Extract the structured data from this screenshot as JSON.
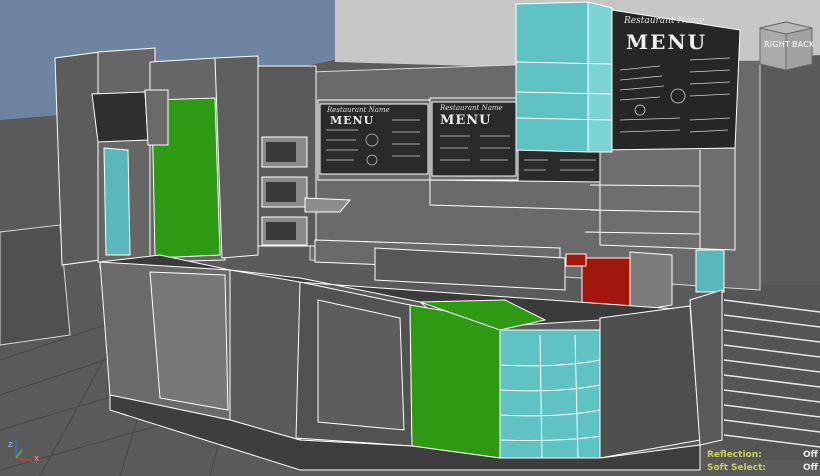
{
  "viewcube": {
    "face_left": "RIGHT",
    "face_right": "BACK"
  },
  "axis": {
    "z_label": "z",
    "x_label": "x"
  },
  "menu_boards": {
    "restaurant_name": "Restaurant Name",
    "menu_word": "MENU"
  },
  "hud": {
    "reflection_label": "Reflection:",
    "reflection_value": "Off",
    "soft_select_label": "Soft Select:",
    "soft_select_value": "Off"
  },
  "colors": {
    "viewport_bg": "#5f5f5f",
    "wire": "#ffffff",
    "green_panel": "#2e9a14",
    "cyan_glass": "#5fc3c4",
    "red_machine": "#a1170e",
    "hud_label": "#c8d25a"
  }
}
